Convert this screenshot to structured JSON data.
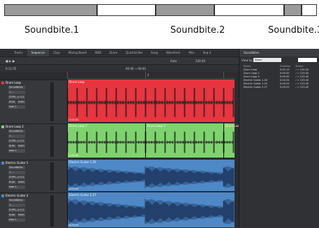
{
  "strip_labels": [
    "Soundbite.1",
    "Soundbite.2",
    "Soundbite.3"
  ],
  "tabs": [
    "Tracks",
    "Sequence",
    "Clips",
    "Mixing Board",
    "MIDI",
    "Drum",
    "QuickScribe",
    "Song",
    "Waveform",
    "Mon",
    "Seq 4"
  ],
  "active_tab": "Sequence",
  "toolbar": {
    "counter": "0:11:55",
    "auto_label": "Auto",
    "tempo": "120.00",
    "range": "00:00 → 00:00"
  },
  "tracks": [
    {
      "name": "Drum Loop",
      "field1": "Soundbites",
      "field2": "1 --",
      "field3": "D-PPL, p 1:2",
      "field4": "Auto",
      "field4b": "main",
      "field5": "take 1",
      "color": "#e8353f"
    },
    {
      "name": "Drum Loop 2",
      "field1": "Soundbites",
      "field2": "1 --",
      "field3": "D-PPL, p 1:2",
      "field4": "Auto",
      "field4b": "main",
      "field5": "take 1",
      "color": "#7ed36e"
    },
    {
      "name": "Electric Guitar 1",
      "field1": "Soundbites",
      "field2": "1 --",
      "field3": "D-PPL, p 1:2",
      "field4": "Auto",
      "field4b": "main",
      "field5": "take 1",
      "color": "#4e88c6"
    },
    {
      "name": "Electric Guitar 2",
      "field1": "Soundbites",
      "field2": "1 --",
      "field3": "D-PPL, p 1:2",
      "field4": "Auto",
      "field4b": "main",
      "field5": "take 1",
      "color": "#4e88c6"
    }
  ],
  "clips": [
    {
      "track": 0,
      "title": "Drum Loop",
      "time": "0:00.00"
    },
    {
      "track": 1,
      "title": "Drum Loop 2",
      "time": "0:00.00"
    },
    {
      "track": 1,
      "title": "Drum Loop 2",
      "time": ""
    },
    {
      "track": 1,
      "title": "Drum Loo",
      "time": ""
    },
    {
      "track": 2,
      "title": "Electric Guitar 1.29",
      "time": "0:00.00"
    },
    {
      "track": 3,
      "title": "Electric Guitar 2.27",
      "time": "0:00.00"
    }
  ],
  "ruler_label": "2",
  "panel": {
    "title": "Soundbites",
    "view_by_label": "View by:",
    "view_by_value": "Name",
    "columns": [
      "Name",
      "Duration",
      "Tempo"
    ],
    "rows": [
      {
        "name": "Drum Loop",
        "duration": "0:02.13",
        "tempo": "♩ = 120.00"
      },
      {
        "name": "Drum Loop 2",
        "duration": "0:00.00",
        "tempo": "♩ = 123.00"
      },
      {
        "name": "Drum Loop 3",
        "duration": "0:00.00",
        "tempo": "♩ = 123.00"
      },
      {
        "name": "Electric Guitar 1.26",
        "duration": "0:04.54",
        "tempo": "♩ = 123.00"
      },
      {
        "name": "Electric Guitar 1.29",
        "duration": "0:00.53",
        "tempo": "♩ = 123.00"
      },
      {
        "name": "Electric Guitar 2.27",
        "duration": "0:00.53",
        "tempo": "♩ = 123.00"
      }
    ]
  }
}
